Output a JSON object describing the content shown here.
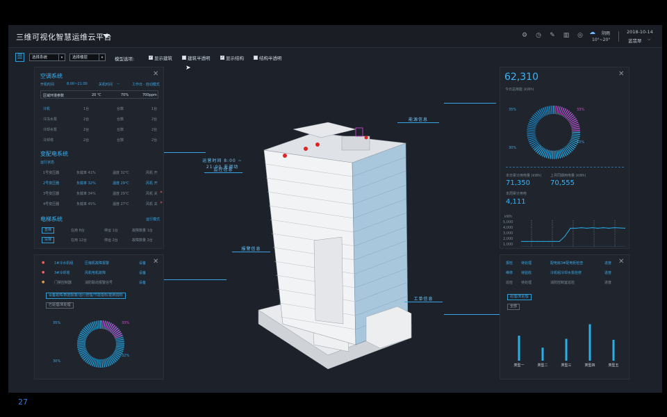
{
  "header": {
    "title": "三维可视化智慧运维云平台",
    "icons": [
      "settings-icon",
      "clock-icon",
      "wrench-icon",
      "chart-icon",
      "target-icon"
    ],
    "weather": {
      "condition": "阴雨",
      "temp": "10°~20°",
      "icon": "cloud-rain-icon"
    },
    "date": "2018-10-14",
    "user": "蓝翡翠"
  },
  "toolbar": {
    "select_system": "选择系统",
    "select_floor": "选择楼层",
    "options_label": "模型选项:",
    "checks": [
      {
        "label": "显示建筑",
        "checked": true
      },
      {
        "label": "建筑半透明",
        "checked": false
      },
      {
        "label": "显示结构",
        "checked": true
      },
      {
        "label": "结构半透明",
        "checked": false
      }
    ]
  },
  "ac_panel": {
    "title": "空调系统",
    "sub1": "开机时间",
    "sub1v": "8:00~21:00",
    "sub2": "关机时间",
    "sub2v": "--",
    "sub3": "工作日 · 自动模式",
    "env_label": "区域环境参数",
    "env_temp": "20 ℃",
    "env_hum": "70%",
    "env_co2": "700ppm",
    "rows": [
      {
        "a": "冷机",
        "b": "1台",
        "c": "台数",
        "d": "1台"
      },
      {
        "a": "冷冻水泵",
        "b": "2台",
        "c": "台数",
        "d": "2台"
      },
      {
        "a": "冷却水泵",
        "b": "2台",
        "c": "台数",
        "d": "2台"
      },
      {
        "a": "冷却塔",
        "b": "2台",
        "c": "台数",
        "d": "2台"
      }
    ]
  },
  "power_panel": {
    "title": "变配电系统",
    "sub": "运行状态",
    "rows": [
      {
        "a": "1号变压器",
        "b": "负载率 41%",
        "c": "温度 32℃",
        "d": "风机 开",
        "alarm": false
      },
      {
        "a": "2号变压器",
        "b": "负载率 32%",
        "c": "温度 29℃",
        "d": "风机 开",
        "alarm": false
      },
      {
        "a": "3号变压器",
        "b": "负载率 34%",
        "c": "温度 29℃",
        "d": "风机 关",
        "alarm": true
      },
      {
        "a": "4号变压器",
        "b": "负载率 45%",
        "c": "温度 27℃",
        "d": "风机 关",
        "alarm": true
      }
    ]
  },
  "elevator_panel": {
    "title": "电梯系统",
    "sub": "运行模式",
    "rows": [
      {
        "btn": "直梯",
        "a": "在用 8台",
        "b": "停运 1台",
        "c": "故障数量 1台"
      },
      {
        "btn": "扶梯",
        "a": "在用 12台",
        "b": "停运 2台",
        "c": "故障数量 2台"
      }
    ]
  },
  "alarm_panel": {
    "rows": [
      {
        "a": "1#冷水机组",
        "b": "压缩机故障报警",
        "c": "设备"
      },
      {
        "a": "3#冷却塔",
        "b": "风机电机故障",
        "c": "设备"
      },
      {
        "a": "门禁控制器",
        "b": "消防联动报警信号",
        "c": "设备"
      }
    ],
    "btn_filter": "设备故障/数据报警/运行管理/节能指标/能耗指标",
    "btn_alarm": "已处理/未处理",
    "donut_labels": [
      "35%",
      "33%",
      "30%",
      "32%"
    ]
  },
  "energy_panel": {
    "value": "62,310",
    "label": "今日总用能 (kWh)",
    "donut_labels": [
      "35%",
      "33%",
      "30%",
      "10%"
    ],
    "stat1_label": "本日累计用电量 (kWh)",
    "stat1": "71,350",
    "stat2_label": "上月同期用电量 (kWh)",
    "stat2": "70,555",
    "stat3_label": "本周累计用电",
    "stat3": "4,111",
    "y_unit": "kWh",
    "y_ticks": [
      "5,000",
      "4,000",
      "3,000",
      "2,000",
      "1,000"
    ]
  },
  "workorder_panel": {
    "rows": [
      {
        "a": "报检",
        "b": "待处理",
        "c": "配电房3#配电柜检查",
        "d": "进度"
      },
      {
        "a": "维修",
        "b": "待验收",
        "c": "冷机组冷却水泵检修",
        "d": "进度"
      },
      {
        "a": "巡检",
        "b": "待处理",
        "c": "消防控制室巡检",
        "d": "进度"
      }
    ],
    "btn_status": "处理/未处理",
    "btn_small": "全部"
  },
  "callouts": {
    "monitor": "监控信息",
    "monitor_note": "运营时间 8:00 ~ 21:00 无调动",
    "energy": "能源信息",
    "alarm": "报警信息",
    "workorder": "工单信息"
  },
  "page_number": "27",
  "chart_data": [
    {
      "type": "line",
      "ylabel": "kWh",
      "ylim": [
        0,
        5000
      ],
      "x": [
        0,
        1,
        2,
        3,
        4,
        5,
        6,
        7,
        8,
        9,
        10,
        11,
        12,
        13,
        14,
        15,
        16,
        17,
        18,
        19
      ],
      "series": [
        {
          "values": [
            1000,
            1000,
            1000,
            1000,
            1000,
            1000,
            1000,
            1000,
            2000,
            3500,
            3500,
            3600,
            3500,
            3600,
            3500,
            3600,
            3500,
            3600,
            3550,
            3500
          ]
        }
      ],
      "grid": false
    },
    {
      "type": "bar",
      "categories": [
        "类型一",
        "类型二",
        "类型三",
        "类型四",
        "类型五"
      ],
      "values": [
        48,
        25,
        42,
        70,
        40
      ],
      "ylim": [
        0,
        80
      ]
    }
  ],
  "colors": {
    "accent": "#35b6ff",
    "panel": "#20252d",
    "bg": "#1d2129",
    "alarm": "#ff5a5a",
    "magenta": "#d54ad0"
  }
}
